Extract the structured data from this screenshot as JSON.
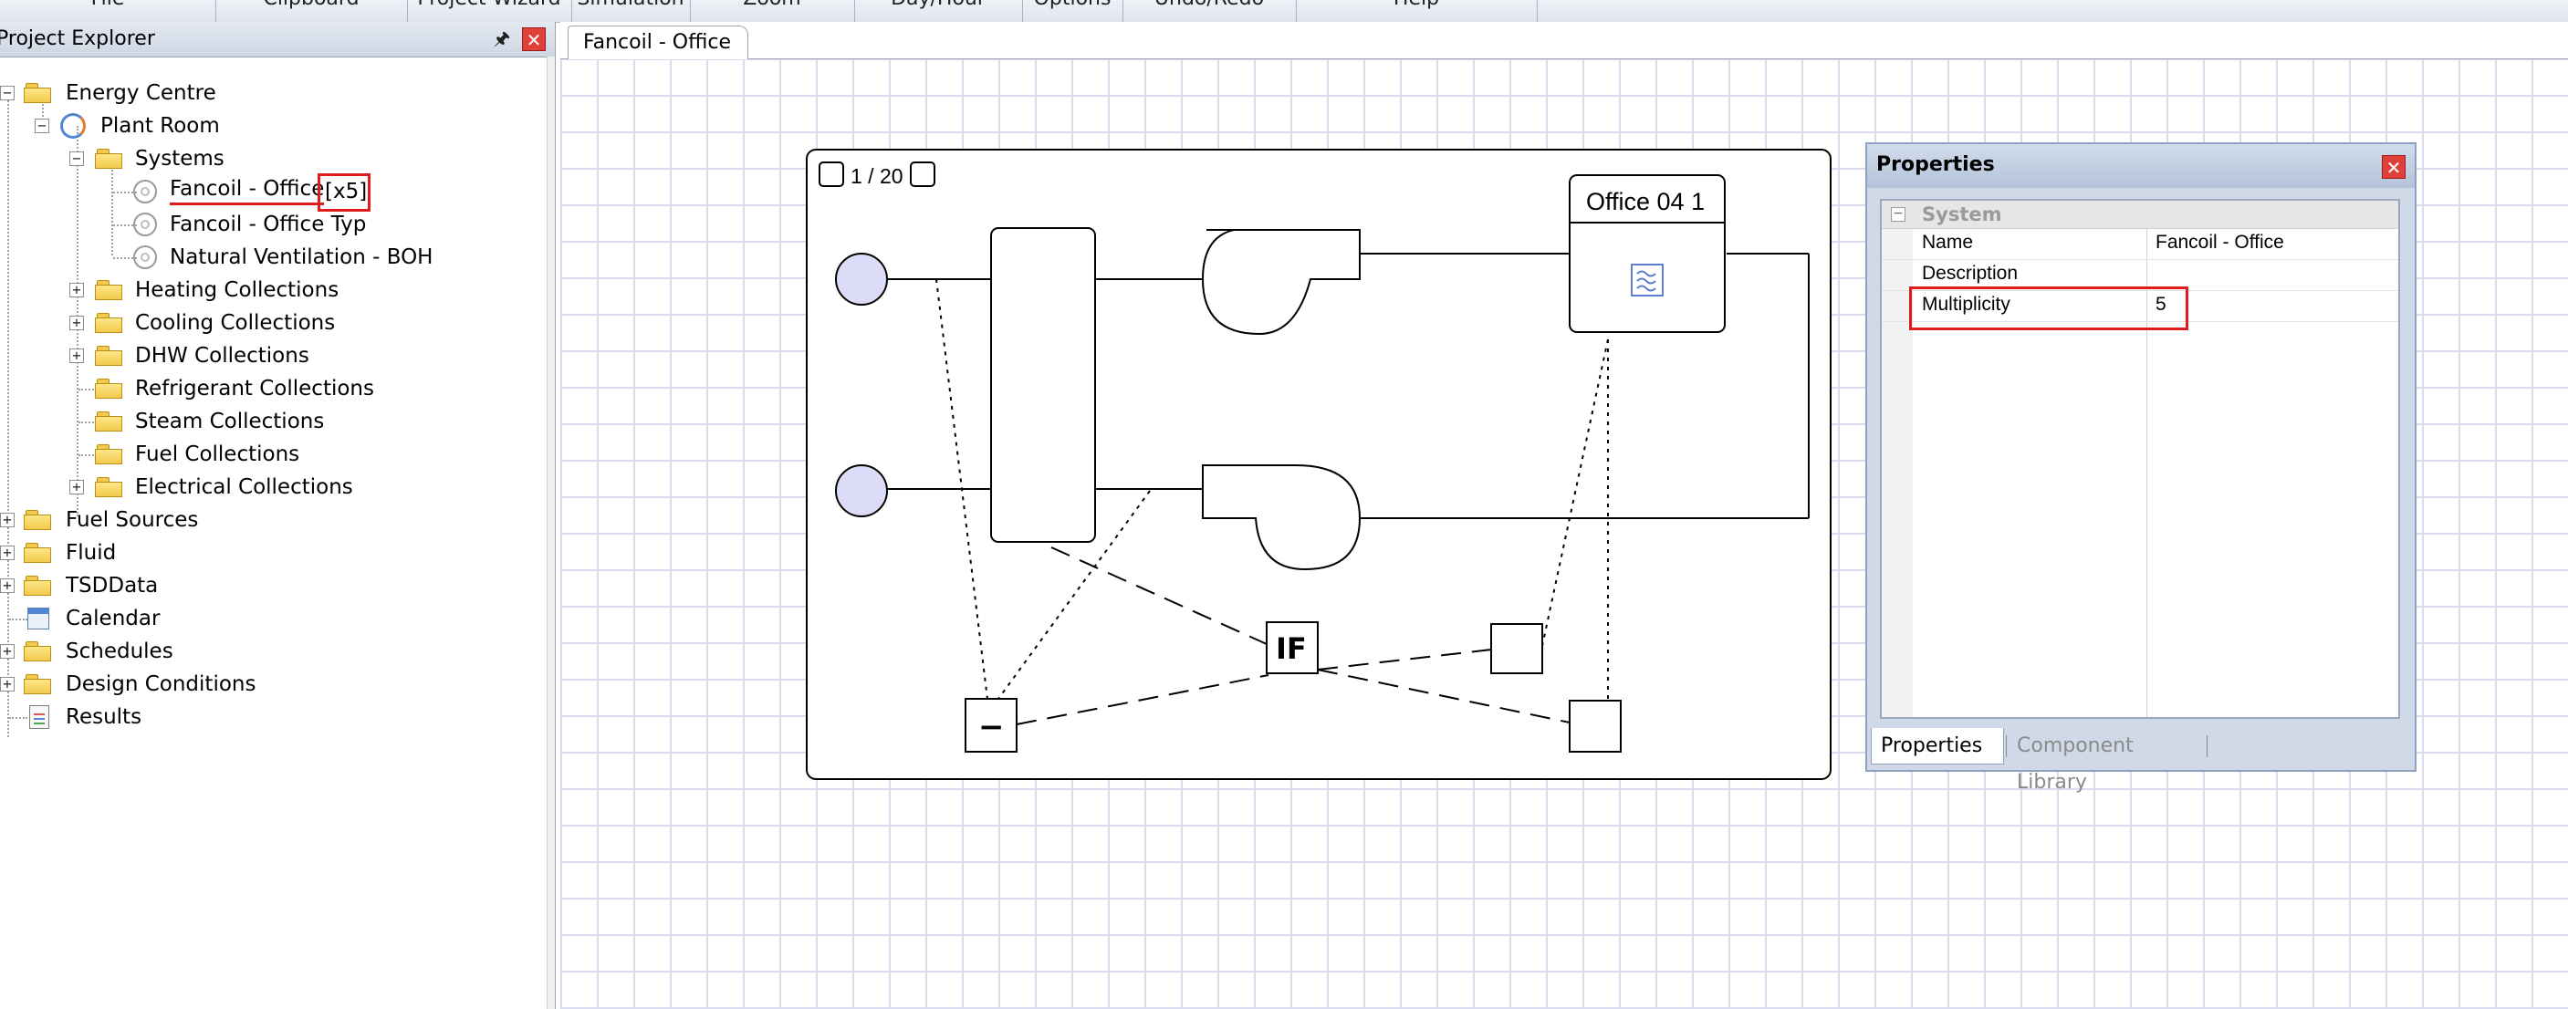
{
  "ribbon": {
    "groups": [
      "File",
      "Clipboard",
      "Project Wizard",
      "Simulation",
      "Zoom",
      "Day/Hour",
      "Options",
      "Undo/Redo",
      "Help"
    ]
  },
  "explorer": {
    "title": "Project Explorer",
    "pin_icon": "pin-icon",
    "close_icon": "close-icon",
    "tree": [
      {
        "label": "Energy Centre",
        "icon": "folder-icon"
      },
      {
        "label": "Plant Room",
        "icon": "plant-room-icon"
      },
      {
        "label": "Systems",
        "icon": "folder-icon"
      },
      {
        "label": "Fancoil - Office",
        "suffix": "[x5]",
        "icon": "system-icon"
      },
      {
        "label": "Fancoil - Office Typ",
        "icon": "system-icon"
      },
      {
        "label": "Natural Ventilation - BOH",
        "icon": "system-icon"
      },
      {
        "label": "Heating Collections",
        "icon": "folder-icon"
      },
      {
        "label": "Cooling Collections",
        "icon": "folder-icon"
      },
      {
        "label": "DHW Collections",
        "icon": "folder-icon"
      },
      {
        "label": "Refrigerant Collections",
        "icon": "folder-icon"
      },
      {
        "label": "Steam Collections",
        "icon": "folder-icon"
      },
      {
        "label": "Fuel Collections",
        "icon": "folder-icon"
      },
      {
        "label": "Electrical Collections",
        "icon": "folder-icon"
      },
      {
        "label": "Fuel Sources",
        "icon": "folder-icon"
      },
      {
        "label": "Fluid",
        "icon": "folder-icon"
      },
      {
        "label": "TSDData",
        "icon": "folder-icon"
      },
      {
        "label": "Calendar",
        "icon": "calendar-icon"
      },
      {
        "label": "Schedules",
        "icon": "folder-icon"
      },
      {
        "label": "Design Conditions",
        "icon": "folder-icon"
      },
      {
        "label": "Results",
        "icon": "results-icon"
      }
    ]
  },
  "document": {
    "tab_label": "Fancoil - Office",
    "schematic": {
      "page_indicator": "1 / 20",
      "space_label": "Office 04 1",
      "controller_label": "IF",
      "sensor_label": "−"
    }
  },
  "properties": {
    "title": "Properties",
    "category": "System",
    "rows": [
      {
        "name": "Name",
        "value": "Fancoil - Office"
      },
      {
        "name": "Description",
        "value": ""
      },
      {
        "name": "Multiplicity",
        "value": "5"
      }
    ],
    "tabs": [
      "Properties",
      "Component Library"
    ]
  },
  "colors": {
    "highlight": "#e01b1b",
    "grid": "#dcdcf0",
    "node_fill": "#dcdcf8"
  }
}
